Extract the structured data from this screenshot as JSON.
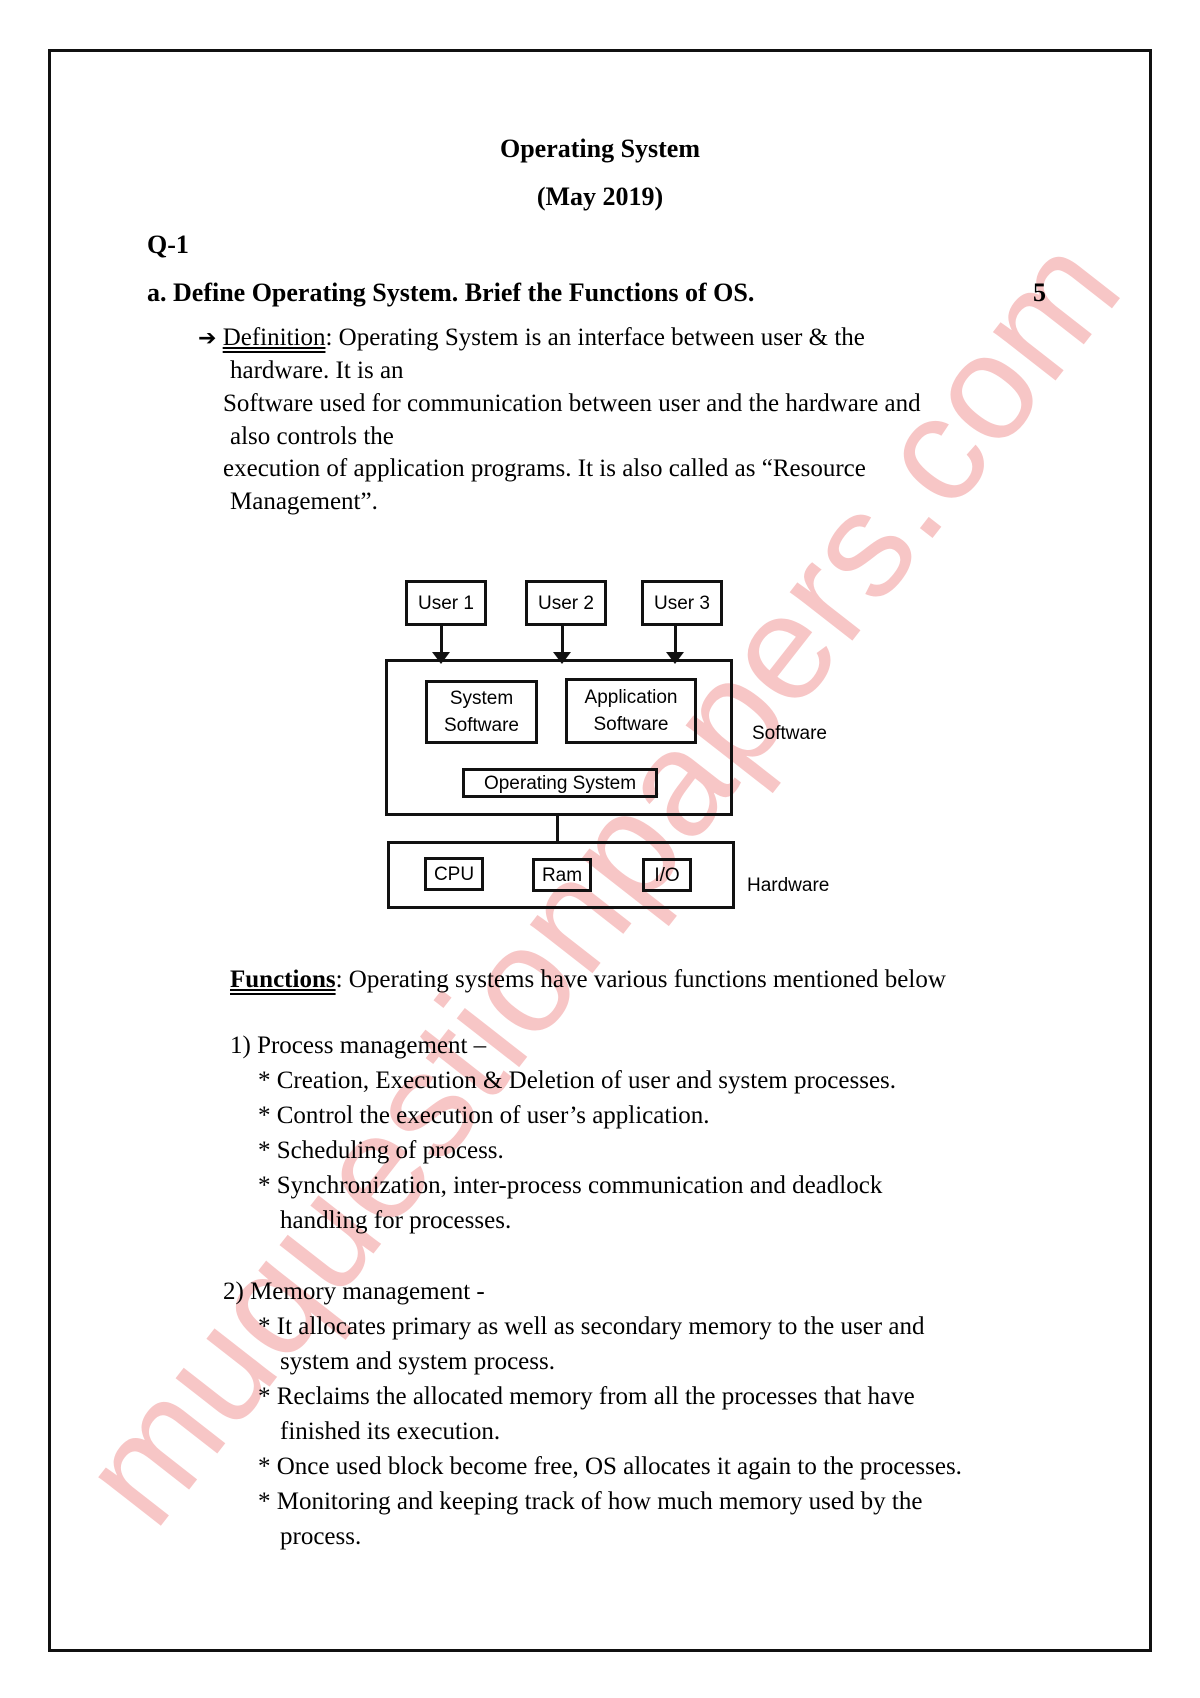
{
  "watermark": "muquestionpapers.com",
  "header": {
    "title": "Operating System",
    "subtitle": "(May 2019)"
  },
  "question": {
    "number": "Q-1",
    "part": "a. Define Operating System. Brief the Functions of OS.",
    "marks": "5"
  },
  "definition": {
    "arrow_icon": "right-arrow",
    "label": "Definition",
    "lines": [
      ": Operating System is an interface between user & the",
      "hardware. It is an",
      "Software used for communication between user and the hardware and",
      "also controls the",
      "execution of application programs. It is also called as “Resource",
      "Management”."
    ]
  },
  "diagram": {
    "users": [
      "User 1",
      "User 2",
      "User 3"
    ],
    "software_boxes": [
      "System\nSoftware",
      "Application\nSoftware"
    ],
    "system_software": [
      "System",
      "Software"
    ],
    "application_software": [
      "Application",
      "Software"
    ],
    "os_box": "Operating System",
    "software_label": "Software",
    "hardware_boxes": [
      "CPU",
      "Ram",
      "I/O"
    ],
    "hardware_label": "Hardware"
  },
  "functions": {
    "label": "Functions",
    "intro": ": Operating systems have various functions mentioned below",
    "sections": [
      {
        "heading": "1) Process management –",
        "items": [
          "* Creation, Execution & Deletion of user and system processes.",
          "* Control the execution of user’s application.",
          "*  Scheduling of process.",
          "* Synchronization, inter-process communication and deadlock",
          "handling for processes."
        ]
      },
      {
        "heading": "2) Memory management -",
        "items": [
          "* It allocates primary as well as secondary memory to the user and",
          "system and system process.",
          "* Reclaims the allocated memory from all the processes that have",
          "finished its execution.",
          "* Once used block become free, OS allocates it again to the processes.",
          "* Monitoring and keeping track of how much memory used by the",
          "process."
        ]
      }
    ]
  }
}
